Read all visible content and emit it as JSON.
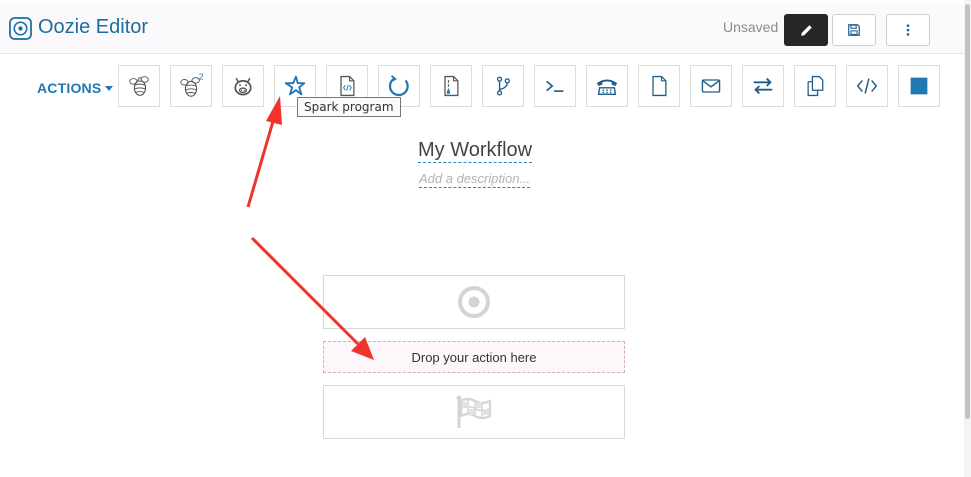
{
  "header": {
    "title": "Oozie Editor",
    "logo_icon": "target-circle-icon",
    "status": "Unsaved",
    "buttons": [
      {
        "icon": "pencil-icon",
        "style": "dark"
      },
      {
        "icon": "floppy-disk-icon"
      },
      {
        "icon": "vertical-ellipsis-icon"
      }
    ]
  },
  "toolbar": {
    "actions_label": "ACTIONS",
    "tools": [
      {
        "icon": "hive-bee-icon"
      },
      {
        "icon": "hive2-bee-icon",
        "superscript": "2"
      },
      {
        "icon": "pig-icon"
      },
      {
        "icon": "spark-star-icon",
        "tooltip": "Spark program"
      },
      {
        "icon": "java-file-icon"
      },
      {
        "icon": "refresh-circle-icon"
      },
      {
        "icon": "mapreduce-file-icon"
      },
      {
        "icon": "code-fork-icon"
      },
      {
        "icon": "terminal-prompt-icon"
      },
      {
        "icon": "telephone-icon"
      },
      {
        "icon": "blank-file-icon"
      },
      {
        "icon": "envelope-icon"
      },
      {
        "icon": "exchange-arrows-icon"
      },
      {
        "icon": "copy-files-icon"
      },
      {
        "icon": "code-brackets-icon"
      },
      {
        "icon": "filled-square-icon"
      }
    ]
  },
  "workflow": {
    "name": "My Workflow",
    "description_placeholder": "Add a description..."
  },
  "canvas": {
    "start_node_icon": "bullseye-icon",
    "dropzone_text": "Drop your action here",
    "end_node_icon": "checkered-flag-icon"
  },
  "annotations": {
    "arrow_color": "#f0332c"
  },
  "colors": {
    "accent": "#1f77b4",
    "title": "#1b6e9f",
    "header_bg": "#fcf9fc"
  }
}
